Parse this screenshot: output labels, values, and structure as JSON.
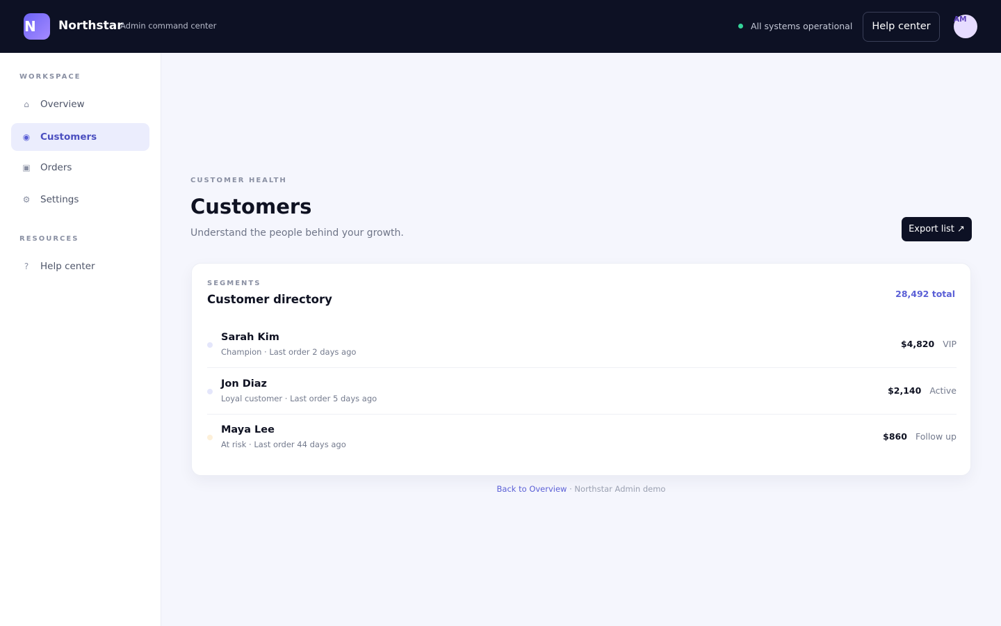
{
  "header": {
    "logo_letter": "N",
    "brand": "Northstar",
    "subtitle": "Admin command center",
    "status_text": "All systems operational",
    "help_label": "Help center",
    "avatar_initials": "AM",
    "colors": {
      "bar": "#0d1124",
      "status_dot": "#34d399",
      "accent": "#5a5fd6"
    }
  },
  "sidebar": {
    "sections": [
      {
        "title": "WORKSPACE",
        "items": [
          {
            "icon": "home-icon",
            "glyph": "⌂",
            "label": "Overview",
            "active": false
          },
          {
            "icon": "customers-icon",
            "glyph": "◉",
            "label": "Customers",
            "active": true
          },
          {
            "icon": "orders-icon",
            "glyph": "▣",
            "label": "Orders",
            "active": false
          },
          {
            "icon": "settings-icon",
            "glyph": "⚙",
            "label": "Settings",
            "active": false
          }
        ]
      },
      {
        "title": "RESOURCES",
        "items": [
          {
            "icon": "help-icon",
            "glyph": "?",
            "label": "Help center",
            "active": false
          }
        ]
      }
    ]
  },
  "main": {
    "eyebrow": "CUSTOMER HEALTH",
    "title": "Customers",
    "subtitle": "Understand the people behind your growth.",
    "export_label": "Export list ↗",
    "card": {
      "eyebrow": "SEGMENTS",
      "title": "Customer directory",
      "total": "28,492 total",
      "customers": [
        {
          "name": "Sarah Kim",
          "meta": "Champion · Last order 2 days ago",
          "amount": "$4,820",
          "tag": "VIP",
          "dot_color": "#e4e6fb"
        },
        {
          "name": "Jon Diaz",
          "meta": "Loyal customer · Last order 5 days ago",
          "amount": "$2,140",
          "tag": "Active",
          "dot_color": "#e4e6fb"
        },
        {
          "name": "Maya Lee",
          "meta": "At risk · Last order 44 days ago",
          "amount": "$860",
          "tag": "Follow up",
          "dot_color": "#fdf0d9"
        }
      ]
    }
  },
  "footer": {
    "link": "Back to Overview",
    "text": " · Northstar Admin demo"
  }
}
